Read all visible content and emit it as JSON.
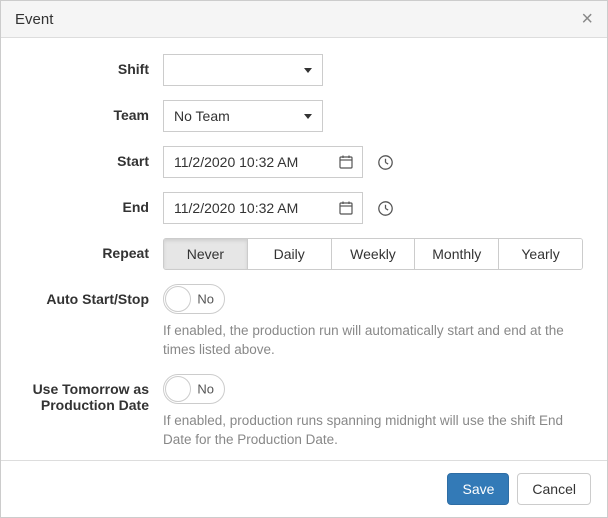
{
  "header": {
    "title": "Event"
  },
  "labels": {
    "shift": "Shift",
    "team": "Team",
    "start": "Start",
    "end": "End",
    "repeat": "Repeat",
    "autoStartStop": "Auto Start/Stop",
    "useTomorrow": "Use Tomorrow as Production Date"
  },
  "fields": {
    "shift": {
      "value": ""
    },
    "team": {
      "value": "No Team"
    },
    "start": {
      "value": "11/2/2020 10:32 AM"
    },
    "end": {
      "value": "11/2/2020 10:32 AM"
    },
    "repeat": {
      "options": {
        "never": "Never",
        "daily": "Daily",
        "weekly": "Weekly",
        "monthly": "Monthly",
        "yearly": "Yearly"
      },
      "selected": "never"
    },
    "autoStartStop": {
      "value": "No"
    },
    "useTomorrow": {
      "value": "No"
    }
  },
  "help": {
    "autoStartStop": "If enabled, the production run will automatically start and end at the times listed above.",
    "useTomorrow": "If enabled, production runs spanning midnight will use the shift End Date for the Production Date."
  },
  "footer": {
    "save": "Save",
    "cancel": "Cancel"
  }
}
